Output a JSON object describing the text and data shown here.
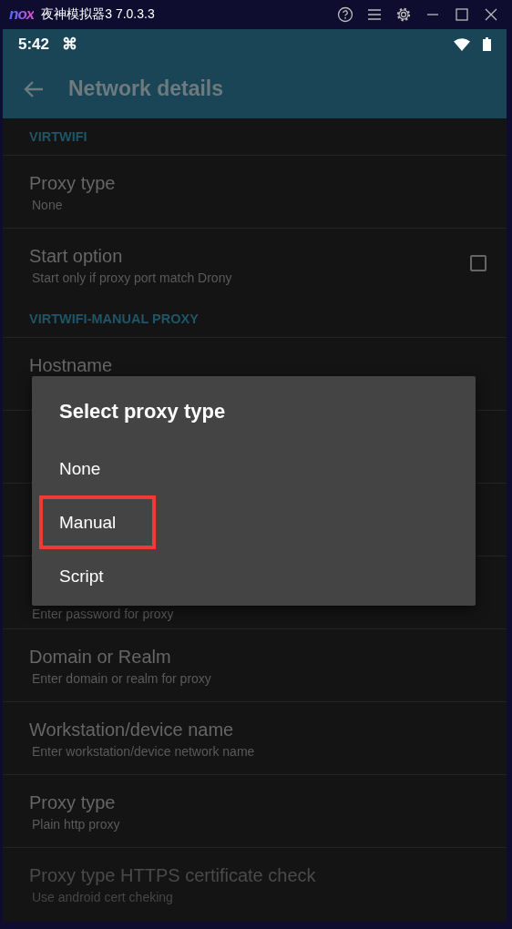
{
  "window": {
    "logo": "nox",
    "title": "夜神模拟器3 7.0.3.3"
  },
  "status_bar": {
    "time": "5:42",
    "notification": "⌘"
  },
  "toolbar": {
    "title": "Network details"
  },
  "settings": [
    {
      "kind": "header",
      "title": "VIRTWIFI"
    },
    {
      "kind": "row",
      "title": "Proxy type",
      "summary": "None",
      "disabled": false
    },
    {
      "kind": "checkbox",
      "title": "Start option",
      "summary": "Start only if proxy port match Drony",
      "checked": false,
      "disabled": false
    },
    {
      "kind": "header",
      "title": "VIRTWIFI-MANUAL PROXY"
    },
    {
      "kind": "row",
      "title": "Hostname",
      "disabled": false
    },
    {
      "kind": "row"
    },
    {
      "kind": "row"
    },
    {
      "kind": "row",
      "summary": "Enter password for proxy"
    },
    {
      "kind": "row",
      "title": "Domain or Realm",
      "summary": "Enter domain or realm for proxy",
      "disabled": false
    },
    {
      "kind": "row",
      "title": "Workstation/device name",
      "summary": "Enter workstation/device network name",
      "disabled": false
    },
    {
      "kind": "row",
      "title": "Proxy type",
      "summary": "Plain http proxy",
      "disabled": false
    },
    {
      "kind": "row",
      "title": "Proxy type HTTPS certificate check",
      "summary": "Use android cert cheking",
      "disabled": true
    }
  ],
  "dialog": {
    "title": "Select proxy type",
    "options": [
      {
        "label": "None",
        "highlighted": false
      },
      {
        "label": "Manual",
        "highlighted": true
      },
      {
        "label": "Script",
        "highlighted": false
      }
    ]
  }
}
